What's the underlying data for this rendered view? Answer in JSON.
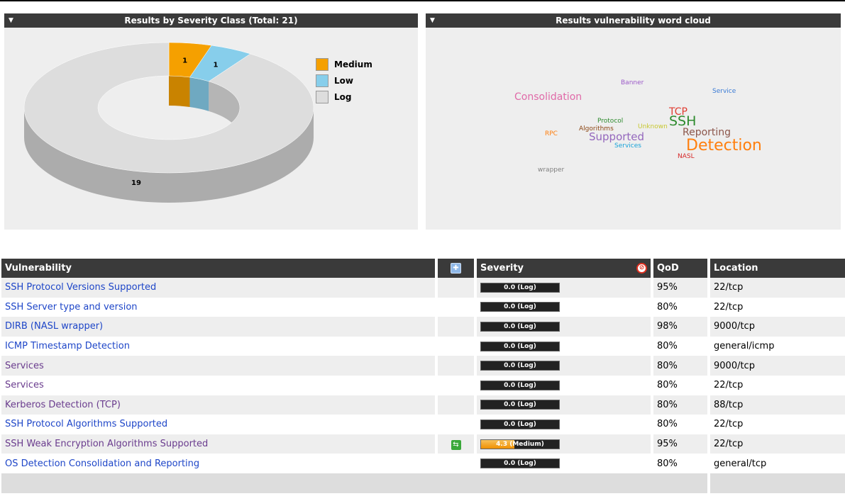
{
  "severity_panel": {
    "title": "Results by Severity Class (Total: 21)",
    "legend": [
      {
        "label": "Medium",
        "color": "#f5a000"
      },
      {
        "label": "Low",
        "color": "#87ceeb"
      },
      {
        "label": "Log",
        "color": "#dddddd"
      }
    ]
  },
  "chart_data": {
    "type": "pie",
    "title": "Results by Severity Class (Total: 21)",
    "categories": [
      "Medium",
      "Low",
      "Log"
    ],
    "values": [
      1,
      1,
      19
    ],
    "colors": [
      "#f5a000",
      "#87ceeb",
      "#dddddd"
    ],
    "labels": [
      "1",
      "1",
      "19"
    ],
    "legend_position": "top-right",
    "style": "3d-donut"
  },
  "wordcloud_panel": {
    "title": "Results vulnerability word cloud",
    "words": [
      {
        "text": "Banner",
        "color": "#9b59c8"
      },
      {
        "text": "Service",
        "color": "#3a7bd5"
      },
      {
        "text": "Consolidation",
        "color": "#e06aa8"
      },
      {
        "text": "TCP",
        "color": "#e03c31"
      },
      {
        "text": "Protocol",
        "color": "#2e8b2e"
      },
      {
        "text": "Unknown",
        "color": "#c8c832"
      },
      {
        "text": "SSH",
        "color": "#2e8b2e"
      },
      {
        "text": "Algorithms",
        "color": "#8b4513"
      },
      {
        "text": "RPC",
        "color": "#ff7f0e"
      },
      {
        "text": "Supported",
        "color": "#9467bd"
      },
      {
        "text": "Reporting",
        "color": "#8c564b"
      },
      {
        "text": "Services",
        "color": "#17a2d8"
      },
      {
        "text": "Detection",
        "color": "#ff7f0e"
      },
      {
        "text": "NASL",
        "color": "#d62728"
      },
      {
        "text": "wrapper",
        "color": "#7f7f7f"
      }
    ]
  },
  "table": {
    "headers": {
      "vulnerability": "Vulnerability",
      "severity": "Severity",
      "qod": "QoD",
      "location": "Location"
    },
    "rows": [
      {
        "name": "SSH Protocol Versions Supported",
        "link": "blue",
        "sev": "0.0 (Log)",
        "sev_fraction": 0.0,
        "qod": "95%",
        "location": "22/tcp",
        "override": false
      },
      {
        "name": "SSH Server type and version",
        "link": "blue",
        "sev": "0.0 (Log)",
        "sev_fraction": 0.0,
        "qod": "80%",
        "location": "22/tcp",
        "override": false
      },
      {
        "name": "DIRB (NASL wrapper)",
        "link": "blue",
        "sev": "0.0 (Log)",
        "sev_fraction": 0.0,
        "qod": "98%",
        "location": "9000/tcp",
        "override": false
      },
      {
        "name": "ICMP Timestamp Detection",
        "link": "blue",
        "sev": "0.0 (Log)",
        "sev_fraction": 0.0,
        "qod": "80%",
        "location": "general/icmp",
        "override": false
      },
      {
        "name": "Services",
        "link": "purple",
        "sev": "0.0 (Log)",
        "sev_fraction": 0.0,
        "qod": "80%",
        "location": "9000/tcp",
        "override": false
      },
      {
        "name": "Services",
        "link": "purple",
        "sev": "0.0 (Log)",
        "sev_fraction": 0.0,
        "qod": "80%",
        "location": "22/tcp",
        "override": false
      },
      {
        "name": "Kerberos Detection (TCP)",
        "link": "purple",
        "sev": "0.0 (Log)",
        "sev_fraction": 0.0,
        "qod": "80%",
        "location": "88/tcp",
        "override": false
      },
      {
        "name": "SSH Protocol Algorithms Supported",
        "link": "blue",
        "sev": "0.0 (Log)",
        "sev_fraction": 0.0,
        "qod": "80%",
        "location": "22/tcp",
        "override": false
      },
      {
        "name": "SSH Weak Encryption Algorithms Supported",
        "link": "purple",
        "sev": "4.3 (Medium)",
        "sev_fraction": 0.43,
        "qod": "95%",
        "location": "22/tcp",
        "override": true
      },
      {
        "name": "OS Detection Consolidation and Reporting",
        "link": "blue",
        "sev": "0.0 (Log)",
        "sev_fraction": 0.0,
        "qod": "80%",
        "location": "general/tcp",
        "override": false
      }
    ]
  },
  "colors": {
    "header_bg": "#3a3a3a",
    "link_blue": "#1e46c8",
    "link_purple": "#6a3c8e",
    "medium": "#f5a000"
  }
}
